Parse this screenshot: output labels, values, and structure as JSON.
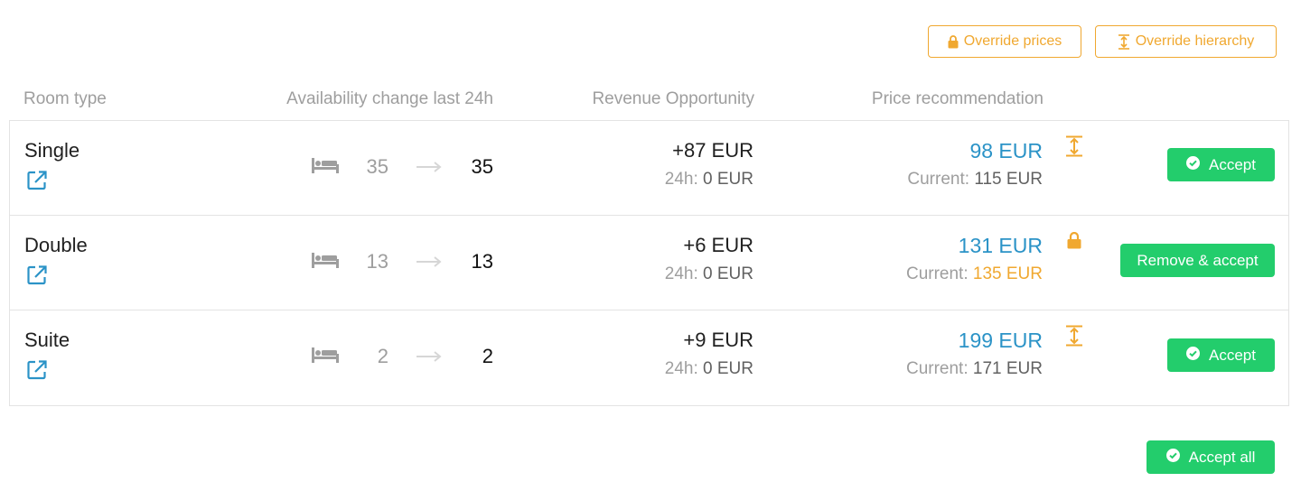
{
  "toolbar": {
    "override_prices_label": "Override prices",
    "override_hierarchy_label": "Override hierarchy"
  },
  "columns": {
    "room_type": "Room type",
    "availability": "Availability change last 24h",
    "revenue": "Revenue Opportunity",
    "price": "Price recommendation"
  },
  "rows": [
    {
      "name": "Single",
      "avail_prev": "35",
      "avail_now": "35",
      "revenue": "+87 EUR",
      "revenue_24h_label": "24h:",
      "revenue_24h_value": "0 EUR",
      "price": "98 EUR",
      "current_label": "Current:",
      "current_value": "115 EUR",
      "status_icon": "hierarchy-icon",
      "action_label": "Accept"
    },
    {
      "name": "Double",
      "avail_prev": "13",
      "avail_now": "13",
      "revenue": "+6 EUR",
      "revenue_24h_label": "24h:",
      "revenue_24h_value": "0 EUR",
      "price": "131 EUR",
      "current_label": "Current:",
      "current_value": "135 EUR",
      "status_icon": "lock-icon",
      "action_label": "Remove & accept"
    },
    {
      "name": "Suite",
      "avail_prev": "2",
      "avail_now": "2",
      "revenue": "+9 EUR",
      "revenue_24h_label": "24h:",
      "revenue_24h_value": "0 EUR",
      "price": "199 EUR",
      "current_label": "Current:",
      "current_value": "171 EUR",
      "status_icon": "hierarchy-icon",
      "action_label": "Accept"
    }
  ],
  "footer": {
    "accept_all_label": "Accept all"
  },
  "colors": {
    "accent_orange": "#f0a830",
    "price_blue": "#2b93c7",
    "accept_green": "#23cd6c"
  }
}
